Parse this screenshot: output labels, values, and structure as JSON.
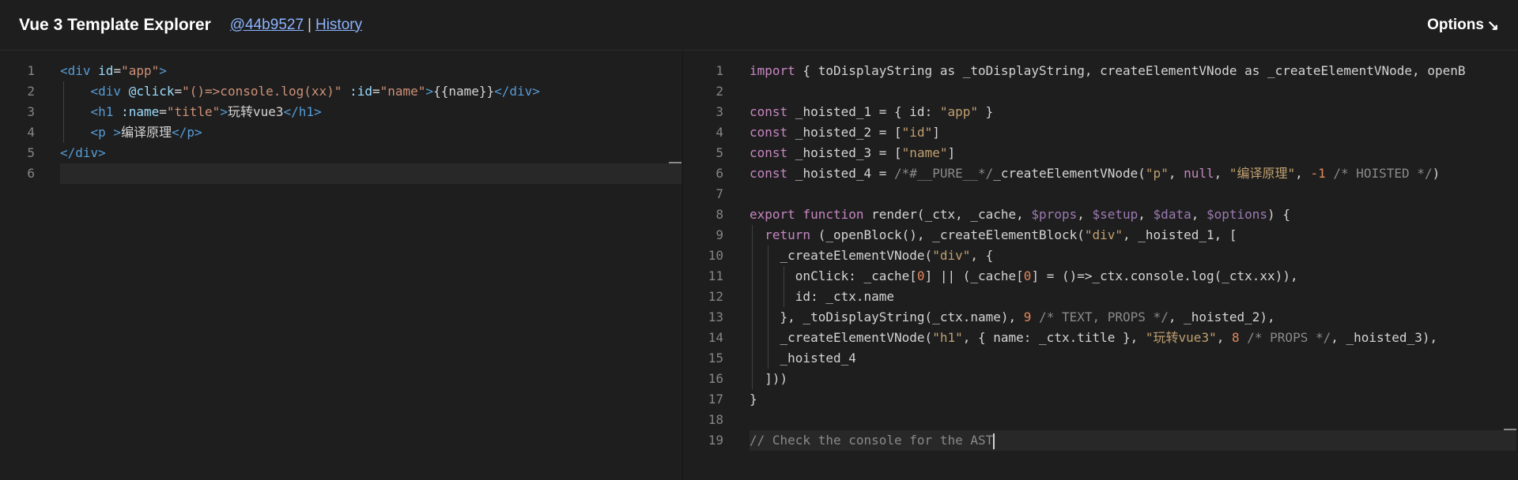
{
  "header": {
    "title": "Vue 3 Template Explorer",
    "commit_link": "@44b9527",
    "separator": "|",
    "history_link": "History",
    "options_label": "Options",
    "options_arrow": "↘"
  },
  "editor_left": {
    "language": "html",
    "lines": [
      [
        [
          "tag",
          "<div "
        ],
        [
          "attr",
          "id"
        ],
        [
          "plain",
          "="
        ],
        [
          "str",
          "\"app\""
        ],
        [
          "tag",
          ">"
        ]
      ],
      [
        [
          "plain",
          "    "
        ],
        [
          "tag",
          "<div "
        ],
        [
          "attr",
          "@click"
        ],
        [
          "plain",
          "="
        ],
        [
          "str",
          "\"()=>console.log(xx)\""
        ],
        [
          "plain",
          " "
        ],
        [
          "attr",
          ":id"
        ],
        [
          "plain",
          "="
        ],
        [
          "str",
          "\"name\""
        ],
        [
          "tag",
          ">"
        ],
        [
          "plain",
          "{{name}}"
        ],
        [
          "tag",
          "</div>"
        ]
      ],
      [
        [
          "plain",
          "    "
        ],
        [
          "tag",
          "<h1 "
        ],
        [
          "attr",
          ":name"
        ],
        [
          "plain",
          "="
        ],
        [
          "str",
          "\"title\""
        ],
        [
          "tag",
          ">"
        ],
        [
          "plain",
          "玩转vue3"
        ],
        [
          "tag",
          "</h1>"
        ]
      ],
      [
        [
          "plain",
          "    "
        ],
        [
          "tag",
          "<p "
        ],
        [
          "tag",
          ">"
        ],
        [
          "plain",
          "编译原理"
        ],
        [
          "tag",
          "</p>"
        ]
      ],
      [
        [
          "tag",
          "</div>"
        ]
      ],
      [
        [
          "plain",
          ""
        ]
      ]
    ]
  },
  "editor_right": {
    "language": "javascript",
    "lines": [
      [
        [
          "kw",
          "import"
        ],
        [
          "plain",
          " { toDisplayString as _toDisplayString, createElementVNode as _createElementVNode, openB"
        ]
      ],
      [
        [
          "plain",
          ""
        ]
      ],
      [
        [
          "kw",
          "const"
        ],
        [
          "plain",
          " _hoisted_1 = { id: "
        ],
        [
          "lit",
          "\"app\""
        ],
        [
          "plain",
          " }"
        ]
      ],
      [
        [
          "kw",
          "const"
        ],
        [
          "plain",
          " _hoisted_2 = ["
        ],
        [
          "lit",
          "\"id\""
        ],
        [
          "plain",
          "]"
        ]
      ],
      [
        [
          "kw",
          "const"
        ],
        [
          "plain",
          " _hoisted_3 = ["
        ],
        [
          "lit",
          "\"name\""
        ],
        [
          "plain",
          "]"
        ]
      ],
      [
        [
          "kw",
          "const"
        ],
        [
          "plain",
          " _hoisted_4 = "
        ],
        [
          "cm",
          "/*#__PURE__*/"
        ],
        [
          "plain",
          "_createElementVNode("
        ],
        [
          "lit",
          "\"p\""
        ],
        [
          "plain",
          ", "
        ],
        [
          "kw",
          "null"
        ],
        [
          "plain",
          ", "
        ],
        [
          "lit",
          "\"编译原理\""
        ],
        [
          "plain",
          ", "
        ],
        [
          "num",
          "-1"
        ],
        [
          "plain",
          " "
        ],
        [
          "cm",
          "/* HOISTED */"
        ],
        [
          "plain",
          ")"
        ]
      ],
      [
        [
          "plain",
          ""
        ]
      ],
      [
        [
          "kw",
          "export function"
        ],
        [
          "plain",
          " render(_ctx, _cache, "
        ],
        [
          "var",
          "$props"
        ],
        [
          "plain",
          ", "
        ],
        [
          "var",
          "$setup"
        ],
        [
          "plain",
          ", "
        ],
        [
          "var",
          "$data"
        ],
        [
          "plain",
          ", "
        ],
        [
          "var",
          "$options"
        ],
        [
          "plain",
          ") {"
        ]
      ],
      [
        [
          "plain",
          "  "
        ],
        [
          "kw",
          "return"
        ],
        [
          "plain",
          " (_openBlock(), _createElementBlock("
        ],
        [
          "lit",
          "\"div\""
        ],
        [
          "plain",
          ", _hoisted_1, ["
        ]
      ],
      [
        [
          "plain",
          "    _createElementVNode("
        ],
        [
          "lit",
          "\"div\""
        ],
        [
          "plain",
          ", {"
        ]
      ],
      [
        [
          "plain",
          "      onClick: _cache["
        ],
        [
          "num",
          "0"
        ],
        [
          "plain",
          "] || (_cache["
        ],
        [
          "num",
          "0"
        ],
        [
          "plain",
          "] = ()=>_ctx.console.log(_ctx.xx)),"
        ]
      ],
      [
        [
          "plain",
          "      id: _ctx.name"
        ]
      ],
      [
        [
          "plain",
          "    }, _toDisplayString(_ctx.name), "
        ],
        [
          "num",
          "9"
        ],
        [
          "plain",
          " "
        ],
        [
          "cm",
          "/* TEXT, PROPS */"
        ],
        [
          "plain",
          ", _hoisted_2),"
        ]
      ],
      [
        [
          "plain",
          "    _createElementVNode("
        ],
        [
          "lit",
          "\"h1\""
        ],
        [
          "plain",
          ", { name: _ctx.title }, "
        ],
        [
          "lit",
          "\"玩转vue3\""
        ],
        [
          "plain",
          ", "
        ],
        [
          "num",
          "8"
        ],
        [
          "plain",
          " "
        ],
        [
          "cm",
          "/* PROPS */"
        ],
        [
          "plain",
          ", _hoisted_3),"
        ]
      ],
      [
        [
          "plain",
          "    _hoisted_4"
        ]
      ],
      [
        [
          "plain",
          "  ]))"
        ]
      ],
      [
        [
          "plain",
          "}"
        ]
      ],
      [
        [
          "plain",
          ""
        ]
      ],
      [
        [
          "cm",
          "// Check the console for the AST"
        ]
      ]
    ]
  }
}
